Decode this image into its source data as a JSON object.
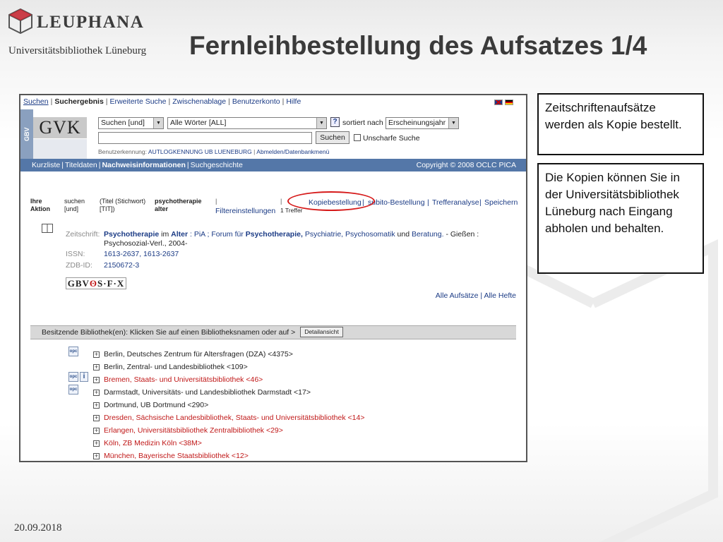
{
  "header": {
    "logo_text": "LEUPHANA",
    "logo_subtitle": "Universitätsbibliothek Lüneburg",
    "slide_title": "Fernleihbestellung des Aufsatzes 1/4"
  },
  "topnav": {
    "items": [
      "Suchen",
      "Suchergebnis",
      "Erweiterte Suche",
      "Zwischenablage",
      "Benutzerkonto",
      "Hilfe"
    ]
  },
  "search": {
    "side_label": "GBV",
    "logo": "GVK",
    "mode_select": "Suchen [und]",
    "words_select": "Alle Wörter [ALL]",
    "help": "?",
    "sort_label": "sortiert nach",
    "sort_select": "Erscheinungsjahr",
    "search_button": "Suchen",
    "fuzzy_label": "Unscharfe Suche",
    "user_label": "Benutzerkennung:",
    "user_value": "AUTLOGKENNUNG UB LUENEBURG",
    "logout": "Abmelden/Datenbankmenü"
  },
  "bluebar": {
    "items": [
      "Kurzliste",
      "Titeldaten",
      "Nachweisinformationen",
      "Suchgeschichte"
    ],
    "copyright": "Copyright © 2008 OCLC PICA"
  },
  "actionrow": {
    "col1_line1": "Ihre",
    "col1_line2": "Aktion",
    "col2_line1": "suchen",
    "col2_line2": "[und]",
    "col3_line1": "(Titel (Stichwort)",
    "col3_line2": "[TIT])",
    "col4_line1": "psychotherapie",
    "col4_line2": "alter",
    "filter": "Filtereinstellungen",
    "hits": "1 Treffer",
    "copy_order": "Kopiebestellung",
    "subito": "subito-Bestellung",
    "analysis": "Trefferanalyse",
    "save": "Speichern"
  },
  "record": {
    "journal_label": "Zeitschrift:",
    "journal_title": "Psychotherapie",
    "journal_in": "im",
    "journal_alter": "Alter",
    "journal_rest": ": PiA ; Forum für",
    "journal_psy": "Psychotherapie,",
    "journal_rest2": "Psychiatrie, Psychosomatik",
    "journal_und": "und",
    "journal_beratung": "Beratung.",
    "journal_place": "- Gießen :",
    "journal_publisher": "Psychosozial-Verl., 2004-",
    "issn_label": "ISSN:",
    "issn_value": "1613-2637, 1613-2637",
    "zdb_label": "ZDB-ID:",
    "zdb_value": "2150672-3",
    "sfx_left": "GBV",
    "sfx_right": "S·F·X",
    "all_articles": "Alle Aufsätze",
    "all_issues": "Alle Hefte"
  },
  "holdings": {
    "bar_text": "Besitzende Bibliothek(en): Klicken Sie auf einen Bibliotheksnamen oder auf >",
    "detail_button": "Detailansicht",
    "libraries": [
      {
        "name": "Berlin, Deutsches Zentrum für Altersfragen (DZA) <4375>",
        "color": "dark"
      },
      {
        "name": "Berlin, Zentral- und Landesbibliothek <109>",
        "color": "dark"
      },
      {
        "name": "Bremen, Staats- und Universitätsbibliothek <46>",
        "color": "red"
      },
      {
        "name": "Darmstadt, Universitäts- und Landesbibliothek Darmstadt <17>",
        "color": "dark"
      },
      {
        "name": "Dortmund, UB Dortmund <290>",
        "color": "dark"
      },
      {
        "name": "Dresden, Sächsische Landesbibliothek, Staats- und Universitätsbibliothek <14>",
        "color": "red"
      },
      {
        "name": "Erlangen, Universitätsbibliothek Zentralbibliothek <29>",
        "color": "red"
      },
      {
        "name": "Köln, ZB Medizin Köln <38M>",
        "color": "red"
      },
      {
        "name": "München, Bayerische Staatsbibliothek <12>",
        "color": "red"
      }
    ]
  },
  "callouts": {
    "box1": "Zeitschriftenaufsätze werden als Kopie bestellt.",
    "box2": "Die Kopien können Sie in der Universitätsbibliothek Lüneburg nach Eingang abholen und behalten."
  },
  "footer": {
    "date": "20.09.2018"
  }
}
